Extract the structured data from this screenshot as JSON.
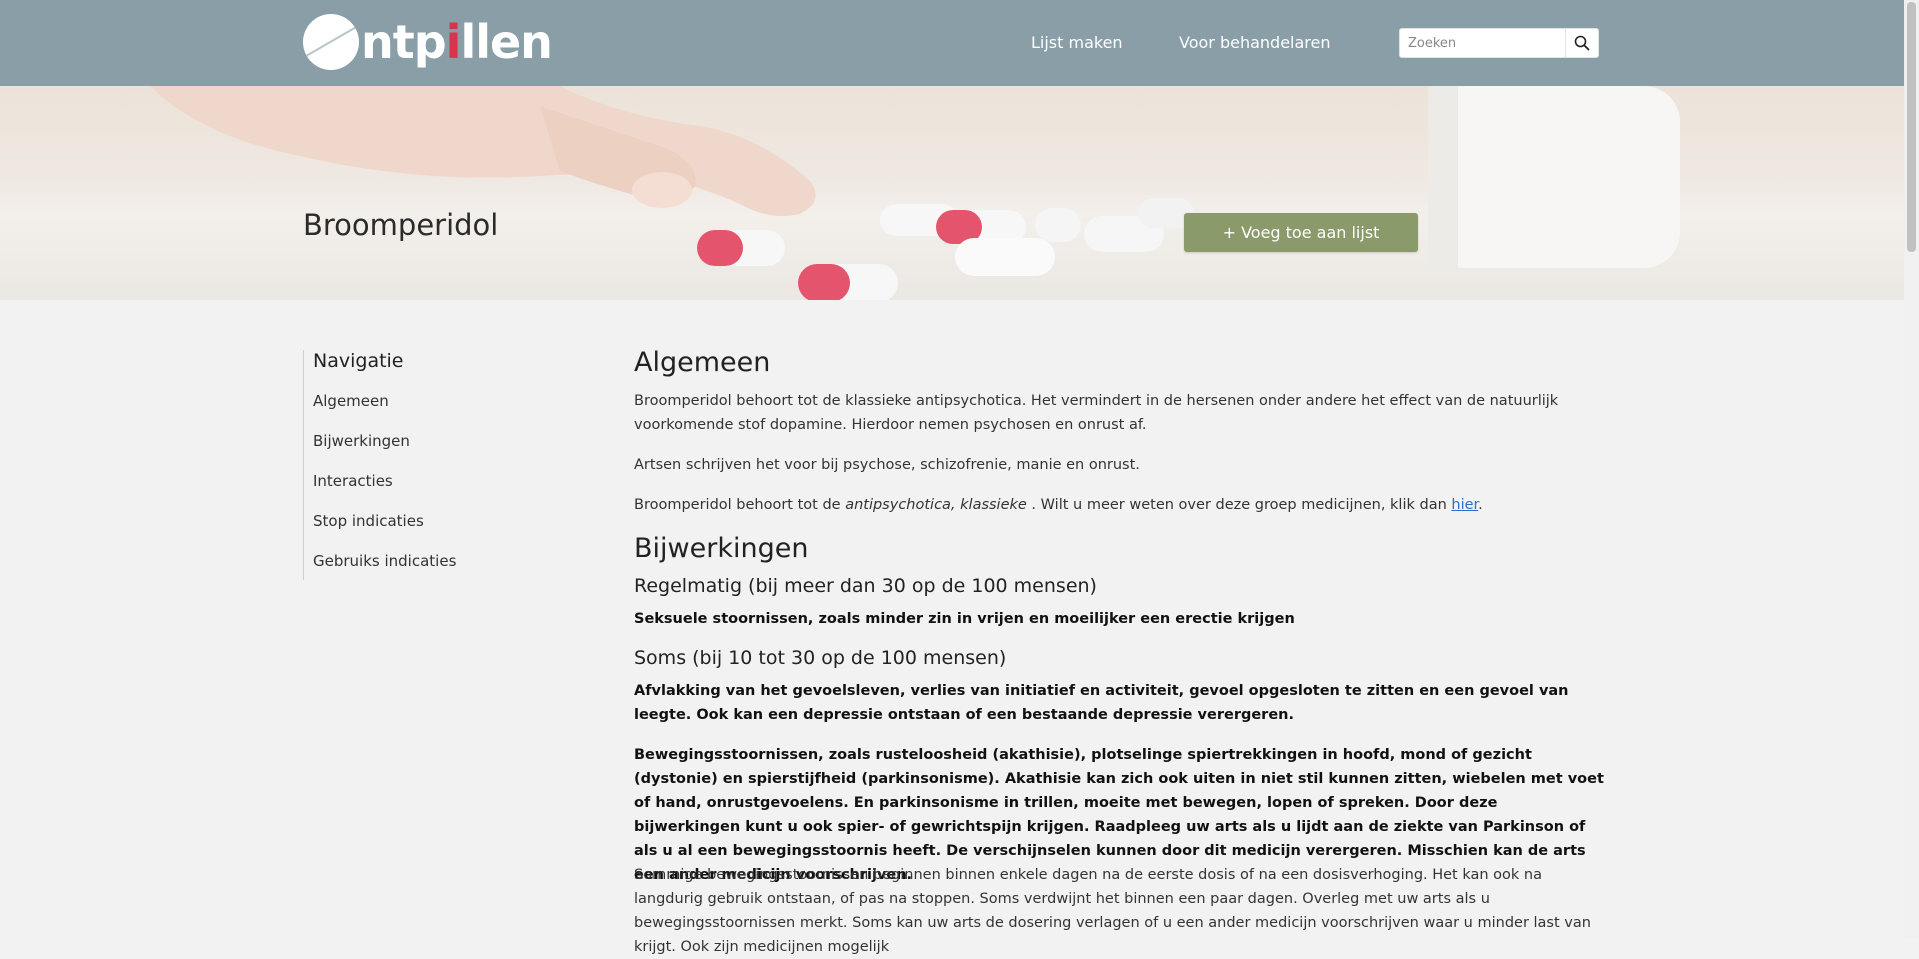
{
  "header": {
    "logo_text_pre": "ntp",
    "logo_text_dot": "i",
    "logo_text_post": "llen",
    "nav": [
      "Lijst maken",
      "Voor behandelaren"
    ],
    "search_placeholder": "Zoeken"
  },
  "hero": {
    "title": "Broomperidol",
    "add_button": "+ Voeg toe aan lijst"
  },
  "sidebar": {
    "title": "Navigatie",
    "items": [
      "Algemeen",
      "Bijwerkingen",
      "Interacties",
      "Stop indicaties",
      "Gebruiks indicaties"
    ]
  },
  "content": {
    "algemeen_title": "Algemeen",
    "algemeen_p1": "Broomperidol behoort tot de klassieke antipsychotica. Het vermindert in de hersenen onder andere het effect van de natuurlijk voorkomende stof dopamine. Hierdoor nemen psychosen en onrust af.",
    "algemeen_p2": "Artsen schrijven het voor bij psychose, schizofrenie, manie en onrust.",
    "algemeen_p3_pre": "Broomperidol behoort tot de ",
    "algemeen_p3_em": "antipsychotica, klassieke",
    "algemeen_p3_mid": " . Wilt u meer weten over deze groep medicijnen, klik dan ",
    "algemeen_p3_link": "hier",
    "algemeen_p3_end": ".",
    "bijwerkingen_title": "Bijwerkingen",
    "regelmatig_title": "Regelmatig (bij meer dan 30 op de 100 mensen)",
    "regelmatig_b1": "Seksuele stoornissen, zoals minder zin in vrijen en moeilijker een erectie krijgen",
    "soms_title": "Soms (bij 10 tot 30 op de 100 mensen)",
    "soms_b1": "Afvlakking van het gevoelsleven, verlies van initiatief en activiteit, gevoel opgesloten te zitten en een gevoel van leegte. Ook kan een depressie ontstaan of een bestaande depressie verergeren.",
    "soms_b2": "Bewegingsstoornissen, zoals rusteloosheid (akathisie), plotselinge spiertrekkingen in hoofd, mond of gezicht (dystonie) en spierstijfheid (parkinsonisme). Akathisie kan zich ook uiten in niet stil kunnen zitten, wiebelen met voet of hand, onrustgevoelens. En parkinsonisme in trillen, moeite met bewegen, lopen of spreken. Door deze bijwerkingen kunt u ook spier- of gewrichtspijn krijgen. Raadpleeg uw arts als u lijdt aan de ziekte van Parkinson of als u al een bewegingsstoornis heeft. De verschijnselen kunnen door dit medicijn verergeren. Misschien kan de arts een ander medicijn voorschrijven.",
    "soms_p": "Sommige bewegingsstoornissen beginnen binnen enkele dagen na de eerste dosis of na een dosisverhoging. Het kan ook na langdurig gebruik ontstaan, of pas na stoppen. Soms verdwijnt het binnen een paar dagen. Overleg met uw arts als u bewegingsstoornissen merkt. Soms kan uw arts de dosering verlagen of u een ander medicijn voorschrijven waar u minder last van krijgt. Ook zijn medicijnen mogelijk"
  },
  "colors": {
    "header_bg": "#8a9ea7",
    "add_button_bg": "#8b9a6a",
    "page_bg": "#f2f2f2",
    "logo_accent": "#d8344e",
    "link": "#2a6ecf"
  },
  "icons": [
    "pill-logo-icon",
    "search-icon"
  ]
}
